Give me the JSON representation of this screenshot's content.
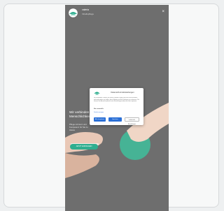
{
  "app": {
    "brand_name": "valeria",
    "brand_sub": "Inhaltspflege",
    "close_label": "×"
  },
  "hero": {
    "title": "Wir verbinden und Menschlichkeit",
    "text": "Pflege mit Herz und Kompetenz für Sie zu Hause",
    "button_label": "JETZT ANFRAGEN"
  },
  "consent_dialog": {
    "title": "Datenschutz-Einstellungen",
    "body": "Wir verwenden Cookies auf unserer Website. Einige von ihnen sind essenziell, während andere uns helfen, diese Website und Ihre Erfahrung zu verbessern. Sie können Ihre Auswahl jederzeit unter Einstellungen widerrufen oder anpassen.",
    "label": "Nur essenzielle",
    "link": "Details anzeigen",
    "buttons": [
      "Alle akzeptieren",
      "Speichern",
      "Individuelle Einstellungen"
    ]
  },
  "colors": {
    "accent": "#2fae8f",
    "button_blue": "#2a6fd6",
    "overlay": "#6e6e6e"
  }
}
